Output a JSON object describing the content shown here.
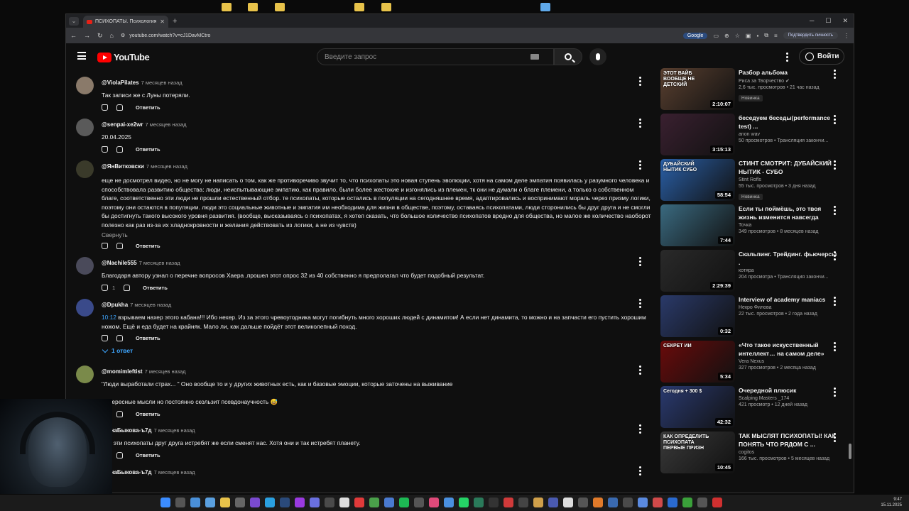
{
  "browser": {
    "tab_title": "ПСИХОПАТЫ. Психология усп",
    "url": "youtube.com/watch?v=cJ1DavMCtro",
    "google_label": "Google",
    "confirm_label": "Подтвердить личность"
  },
  "youtube": {
    "logo_text": "YouTube",
    "search_placeholder": "Введите запрос",
    "signin_label": "Войти"
  },
  "comments": [
    {
      "author": "@ViolaPilates",
      "time": "7 месяцев назад",
      "text": "Так записи же с Луны потеряли.",
      "likes": "",
      "reply": "Ответить",
      "avatar_color": "#8a7a6a"
    },
    {
      "author": "@senpai-xe2wr",
      "time": "7 месяцев назад",
      "text": "20.04.2025",
      "likes": "",
      "reply": "Ответить",
      "avatar_color": "#5a5a5a"
    },
    {
      "author": "@ЯнВитковски",
      "time": "7 месяцев назад",
      "text": "еще не досмотрел видео, но не могу не написать о том, как же противоречиво звучит то, что психопаты это новая ступень эволюции, хотя на самом деле эмпатия появилась у разумного человека и способствовала развитию общества: люди, неиспытывающие эмпатию, как правило, были более жестокие и изгонялись из племен, тк они не думали о благе племени, а только о собственном благе, соответственно эти люди не прошли естественный отбор. те психопаты, которые остались в популяции на сегодняшнее время, адаптировались и воспринимают мораль через призму логики, поэтому они остаются в популяции. люди это социальные животные и эмпатия им необходима для жизни в обществе, поэтому, оставаясь психопатами, люди сторонились бы друг друга и не смогли бы достигнуть такого высокого уровня развития. (вообще, высказываясь о психопатах, я хотел сказать, что большое количество психопатов вредно для общества, но малое же количество наоборот полезно как раз из-за их хладнокровности и желания действовать из логики, а не из чувств)",
      "collapse": "Свернуть",
      "likes": "",
      "reply": "Ответить",
      "avatar_color": "#3a3a2a"
    },
    {
      "author": "@Nachile555",
      "time": "7 месяцев назад",
      "text": "Благодаря  автору узнал о перечне вопросов Хаера ,прошел этот опрос 32 из 40 собственно я предполагал что будет подобный результат.",
      "likes": "1",
      "reply": "Ответить",
      "avatar_color": "#4a4a5a"
    },
    {
      "author": "@Dpukha",
      "time": "7 месяцев назад",
      "timestamp": "10:12",
      "text": " взрываем нахер этого кабана!!! Ибо нехер. Из за этого чревоугодника могут погибнуть много хороших людей с динамитом! А если нет динамита, то можно и на запчасти его пустить хорошим ножом. Ещё и еда будет на крайняк. Мало ли, как дальше пойдёт этот великолепный поход.",
      "likes": "",
      "reply": "Ответить",
      "replies": "1 ответ",
      "avatar_color": "#3a4a8a"
    },
    {
      "author": "@momimleftist",
      "time": "7 месяцев назад",
      "text": "\"Люди выработали страх... \" Оно вообще то и у других животных есть, как и базовые эмоции, которые заточены на выживание\n\nИнтересные мысли но постоянно скользит псевдонаучность 😅",
      "likes": "",
      "reply": "Ответить",
      "avatar_color": "#7a8a4a"
    },
    {
      "author": "@ннаБыкова-ъ7д",
      "time": "7 месяцев назад",
      "text": "Все эти психопаты друг друга истребят же если сменят нас. Хотя они и так истребят планету.",
      "likes": "",
      "reply": "Ответить",
      "avatar_color": "#6a4a6a"
    },
    {
      "author": "@ннаБыкова-ъ7д",
      "time": "7 месяцев назад",
      "text": "",
      "likes": "",
      "reply": "",
      "avatar_color": "#6a4a6a"
    }
  ],
  "sidebar": [
    {
      "title": "Разбор альбома",
      "channel": "Риса за Творчество",
      "verified": true,
      "views": "2,6 тыс. просмотров",
      "age": "21 час назад",
      "duration": "2:10:07",
      "badge": "Новинка",
      "thumb_color": "#5a4030",
      "thumb_text": "ЭТОТ ВАЙБ ВООБЩЕ НЕ ДЕТСКИЙ"
    },
    {
      "title": "беседуем беседы(performance test) ...",
      "channel": "anon wav",
      "views": "50 просмотров",
      "age": "Трансляция закончи...",
      "duration": "3:15:13",
      "badge": "",
      "thumb_color": "#3a2030",
      "thumb_text": ""
    },
    {
      "title": "СТИНТ СМОТРИТ: ДУБАЙСКИЙ НЫТИК - СУБО",
      "channel": "Stint Rofls",
      "views": "55 тыс. просмотров",
      "age": "3 дня назад",
      "duration": "58:54",
      "badge": "Новинка",
      "thumb_color": "#2a60a8",
      "thumb_text": "ДУБАЙСКИЙ НЫТИК СУБО"
    },
    {
      "title": "Если ты поймёшь, это твоя жизнь изменится навсегда",
      "channel": "Точка",
      "views": "349 просмотров",
      "age": "8 месяцев назад",
      "duration": "7:44",
      "badge": "",
      "thumb_color": "#3a6a80",
      "thumb_text": ""
    },
    {
      "title": "Скальпинг. Трейдинг. фьючерсы .",
      "channel": "котяра",
      "views": "204 просмотра",
      "age": "Трансляция закончи...",
      "duration": "2:29:39",
      "badge": "",
      "thumb_color": "#2a2a2a",
      "thumb_text": ""
    },
    {
      "title": "Interview of academy maniacs",
      "channel": "Некро Филова",
      "views": "22 тыс. просмотров",
      "age": "2 года назад",
      "duration": "0:32",
      "badge": "",
      "thumb_color": "#2a3a6a",
      "thumb_text": ""
    },
    {
      "title": "«Что такое искусственный интеллект… на самом деле»",
      "channel": "Vera Nexus",
      "views": "327 просмотров",
      "age": "2 месяца назад",
      "duration": "5:34",
      "badge": "",
      "thumb_color": "#6a0a0a",
      "thumb_text": "СЕКРЕТ ИИ"
    },
    {
      "title": "Очередной плюсик",
      "channel": "Scalping Masters _174",
      "views": "421 просмотр",
      "age": "12 дней назад",
      "duration": "42:32",
      "badge": "",
      "thumb_color": "#2a3a70",
      "thumb_text": "Сегодня + 300 $"
    },
    {
      "title": "ТАК МЫСЛЯТ ПСИХОПАТЫ! КАК ПОНЯТЬ ЧТО РЯДОМ С ...",
      "channel": "cogitos",
      "views": "166 тыс. просмотров",
      "age": "5 месяцев назад",
      "duration": "10:45",
      "badge": "",
      "thumb_color": "#3a3a3a",
      "thumb_text": "КАК ОПРЕДЕЛИТЬ ПСИХОПАТА ПЕРВЫЕ ПРИЗН"
    }
  ],
  "taskbar": {
    "time": "9:47",
    "date": "15.11.2025"
  }
}
